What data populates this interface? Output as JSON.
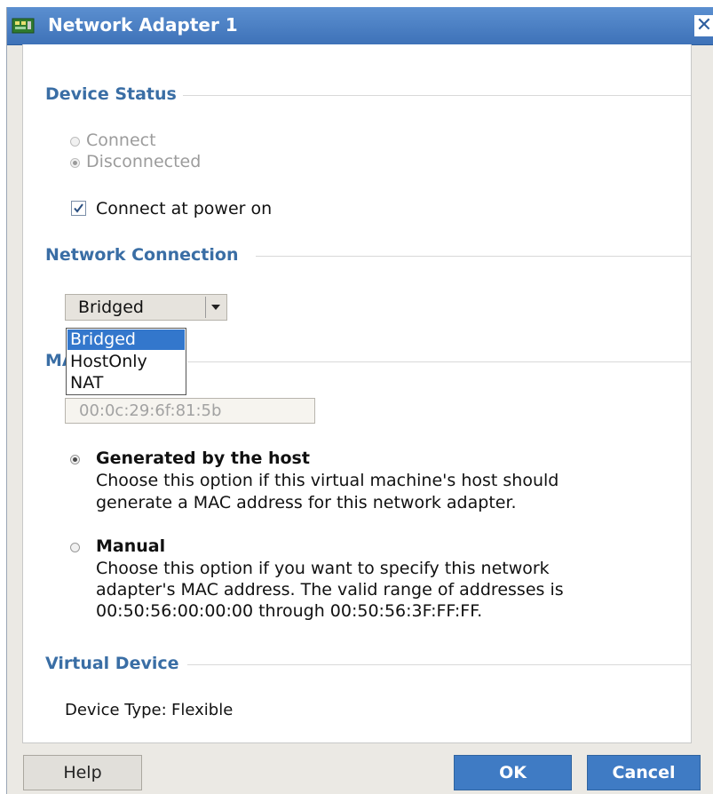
{
  "window": {
    "title": "Network Adapter 1",
    "close_glyph": "✕"
  },
  "device_status": {
    "heading": "Device Status",
    "options": [
      {
        "label": "Connect",
        "selected": false,
        "disabled": true
      },
      {
        "label": "Disconnected",
        "selected": true,
        "disabled": true
      }
    ],
    "connect_at_power_on": {
      "label": "Connect at power on",
      "checked": true
    }
  },
  "network_connection": {
    "heading": "Network Connection",
    "selected": "Bridged",
    "options": [
      "Bridged",
      "HostOnly",
      "NAT"
    ]
  },
  "mac": {
    "heading_visible": "MA",
    "value": "00:0c:29:6f:81:5b",
    "generated": {
      "title": "Generated by the host",
      "selected": true,
      "lines": [
        "Choose this option if this virtual machine's host should",
        "generate a MAC address for this network adapter."
      ]
    },
    "manual": {
      "title": "Manual",
      "selected": false,
      "lines": [
        "Choose this option if you want to specify this network",
        "adapter's MAC address. The valid range of addresses is",
        "00:50:56:00:00:00 through 00:50:56:3F:FF:FF."
      ]
    }
  },
  "virtual_device": {
    "heading": "Virtual Device",
    "device_type_label": "Device Type:",
    "device_type_value": "Flexible"
  },
  "buttons": {
    "help": "Help",
    "ok": "OK",
    "cancel": "Cancel"
  },
  "colors": {
    "title_bar": "#4a80c6",
    "heading": "#3a6ea5",
    "primary_button": "#3f7bc4",
    "selection": "#3377cc"
  }
}
